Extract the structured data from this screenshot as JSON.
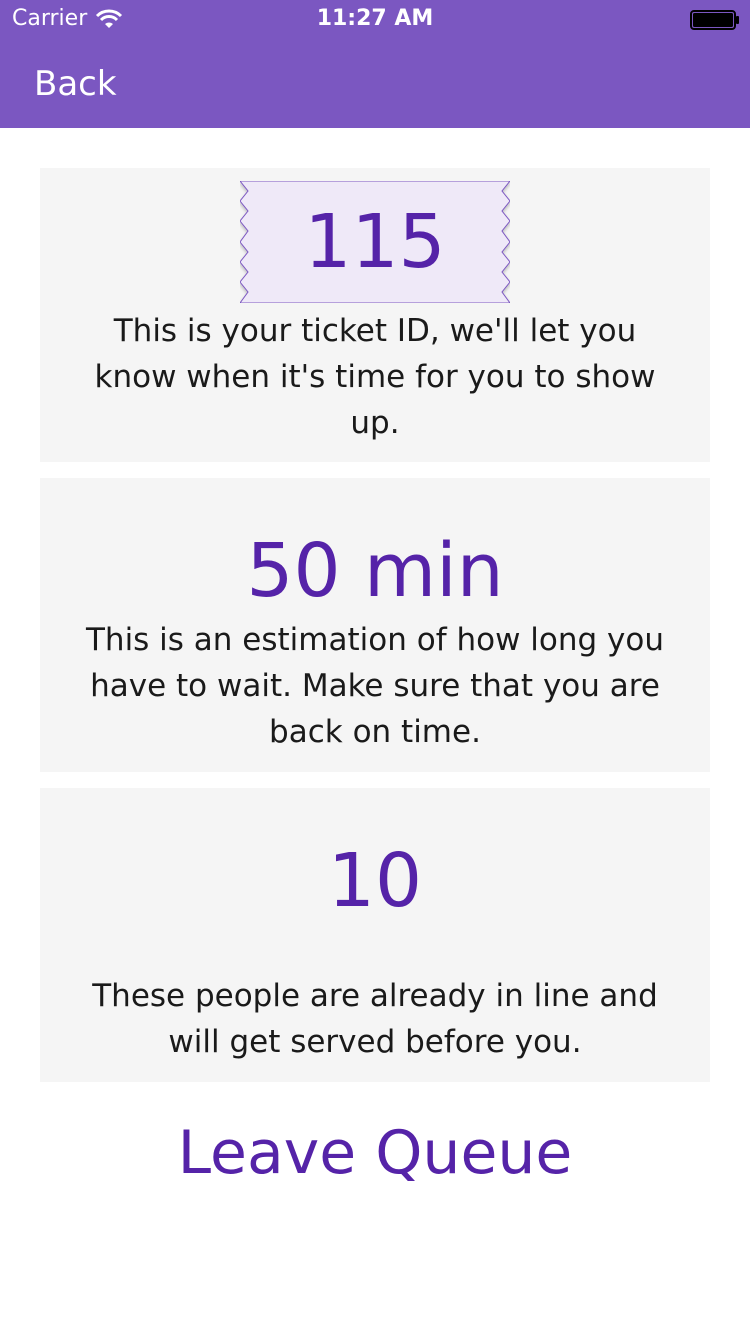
{
  "status_bar": {
    "carrier": "Carrier",
    "time": "11:27 AM"
  },
  "nav": {
    "back_label": "Back"
  },
  "ticket_card": {
    "ticket_id": "115",
    "description": "This is your ticket ID, we'll let you know when it's time for you to show up."
  },
  "wait_card": {
    "value": "50 min",
    "description": "This is an estimation of how long you have to wait. Make sure that you are back on time."
  },
  "queue_card": {
    "value": "10",
    "description": "These people are already in line and will get served before you."
  },
  "actions": {
    "leave_queue_label": "Leave Queue"
  },
  "colors": {
    "header": "#7b57c1",
    "accent": "#5523a8",
    "card_bg": "#f5f5f5",
    "ticket_bg": "#efe9f8"
  }
}
